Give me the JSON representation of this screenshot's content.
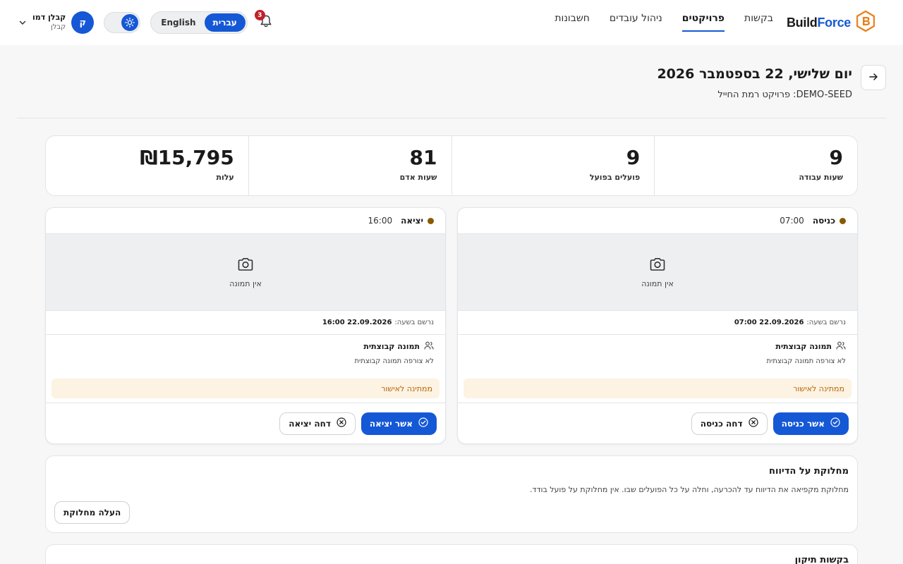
{
  "brand": {
    "name_part1": "Build",
    "name_part2": "Force",
    "accent": "#1558d6",
    "logo_color": "#e8821e"
  },
  "nav": {
    "items": [
      {
        "label": "בקשות",
        "active": false
      },
      {
        "label": "פרויקטים",
        "active": true
      },
      {
        "label": "ניהול עובדים",
        "active": false
      },
      {
        "label": "חשבונות",
        "active": false
      }
    ]
  },
  "notifications": {
    "count": "3",
    "icon": "bell-icon"
  },
  "language": {
    "options": [
      "עברית",
      "English"
    ],
    "selected": "עברית"
  },
  "theme": {
    "icon": "sun-icon"
  },
  "user": {
    "name": "קבלן דמו",
    "role": "קבלן",
    "initial": "ק"
  },
  "page": {
    "title": "יום שלישי, 22 בספטמבר 2026",
    "subtitle": "DEMO-SEED: פרויקט רמת החייל"
  },
  "stats": [
    {
      "value": "9",
      "label": "שעות עבודה"
    },
    {
      "value": "9",
      "label": "פועלים בפועל"
    },
    {
      "value": "81",
      "label": "שעות אדם"
    },
    {
      "value": "₪15,795",
      "label": "עלות"
    }
  ],
  "attendance": {
    "entry": {
      "type": "כניסה",
      "time": "07:00",
      "no_photo": "אין תמונה",
      "recorded_label": "נרשם בשעה:",
      "recorded_value": "22.09.2026 07:00",
      "group_photo_title": "תמונה קבוצתית",
      "group_photo_text": "לא צורפה תמונה קבוצתית",
      "status": "ממתינה לאישור",
      "approve_label": "אשר כניסה",
      "reject_label": "דחה כניסה"
    },
    "exit": {
      "type": "יציאה",
      "time": "16:00",
      "no_photo": "אין תמונה",
      "recorded_label": "נרשם בשעה:",
      "recorded_value": "22.09.2026 16:00",
      "group_photo_title": "תמונה קבוצתית",
      "group_photo_text": "לא צורפה תמונה קבוצתית",
      "status": "ממתינה לאישור",
      "approve_label": "אשר יציאה",
      "reject_label": "דחה יציאה"
    }
  },
  "dispute": {
    "title": "מחלוקת על הדיווח",
    "text": "מחלוקת מקפיאה את הדיווח עד להכרעה, וחלה על כל הפועלים שבו. אין מחלוקת על פועל בודד.",
    "button_label": "העלה מחלוקת"
  },
  "repairs": {
    "title": "בקשות תיקון"
  }
}
